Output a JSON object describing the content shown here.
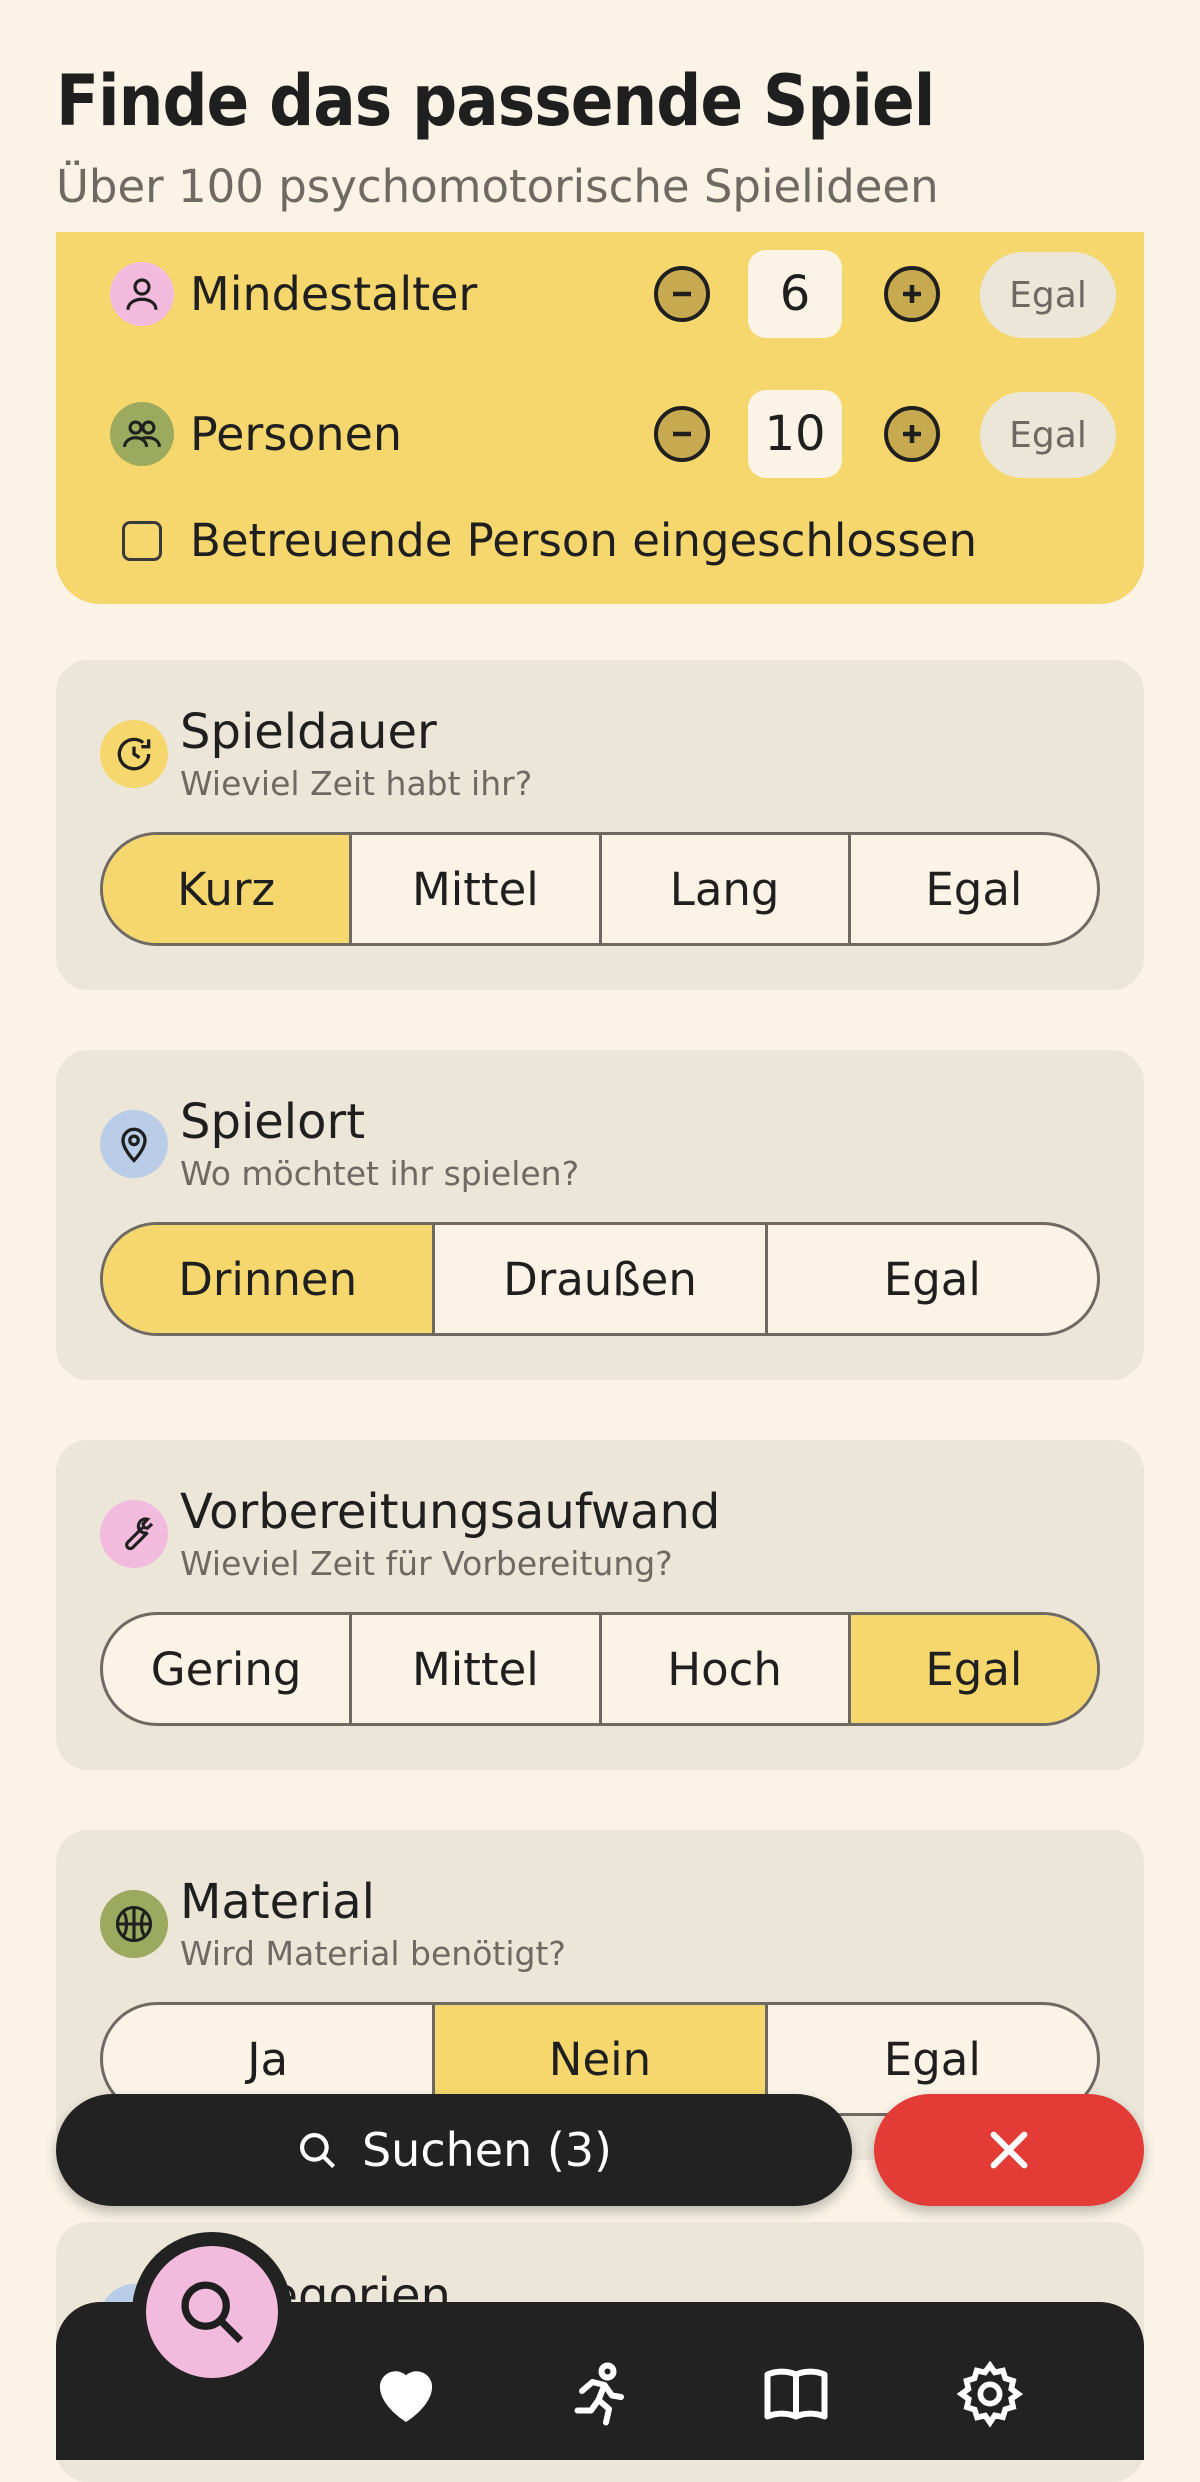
{
  "header": {
    "title": "Finde das passende Spiel",
    "subtitle": "Über 100 psychomotorische Spielideen"
  },
  "filters": {
    "min_age": {
      "label": "Mindestalter",
      "value": "6",
      "egal": "Egal",
      "icon": "person-icon"
    },
    "persons": {
      "label": "Personen",
      "value": "10",
      "egal": "Egal",
      "icon": "group-icon"
    },
    "caretaker": {
      "label": "Betreuende Person eingeschlossen",
      "checked": false
    }
  },
  "cards": {
    "duration": {
      "title": "Spieldauer",
      "subtitle": "Wieviel Zeit habt ihr?",
      "icon": "clock-icon",
      "options": [
        "Kurz",
        "Mittel",
        "Lang",
        "Egal"
      ],
      "selected": "Kurz"
    },
    "location": {
      "title": "Spielort",
      "subtitle": "Wo möchtet ihr spielen?",
      "icon": "location-pin-icon",
      "options": [
        "Drinnen",
        "Draußen",
        "Egal"
      ],
      "selected": "Drinnen"
    },
    "preparation": {
      "title": "Vorbereitungsaufwand",
      "subtitle": "Wieviel Zeit für Vorbereitung?",
      "icon": "wrench-icon",
      "options": [
        "Gering",
        "Mittel",
        "Hoch",
        "Egal"
      ],
      "selected": "Egal"
    },
    "material": {
      "title": "Material",
      "subtitle": "Wird Material benötigt?",
      "icon": "ball-icon",
      "options": [
        "Ja",
        "Nein",
        "Egal"
      ],
      "selected": "Nein"
    },
    "categories_partial": {
      "title": "lkategorien"
    }
  },
  "actions": {
    "search_label": "Suchen (3)"
  },
  "nav": {
    "items": [
      "search-icon",
      "heart-icon",
      "running-person-icon",
      "book-icon",
      "gear-icon"
    ],
    "active": "search-icon"
  },
  "colors": {
    "background": "#FAF3E6",
    "accent_yellow": "#F5D76E",
    "card": "#ECE6D9",
    "dark": "#222222",
    "danger": "#E33B36",
    "active_nav": "#F2BBDD"
  }
}
